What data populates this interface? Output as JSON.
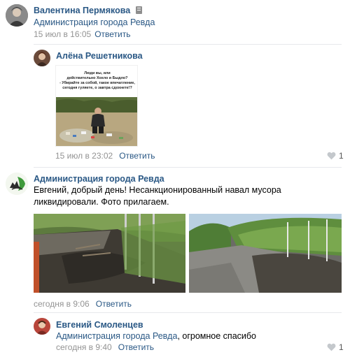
{
  "comments": [
    {
      "author": "Валентина Пермякова",
      "reply_to": "Администрация города Ревда",
      "time": "15 июл в 16:05",
      "reply_label": "Ответить"
    },
    {
      "author": "Алёна Решетникова",
      "image_caption": "Люди вы, или\nдействительно Хохло и Быдло?\n- Убирайте за собой, такое впечатление,\nсегодня гуляете, о завтра сдохнете!?",
      "time": "15 июл в 23:02",
      "reply_label": "Ответить",
      "likes": "1"
    },
    {
      "author": "Администрация города Ревда",
      "text_line1": "Евгений, добрый день! Несанкционированный навал мусора",
      "text_line2": "ликвидировали. Фото прилагаем.",
      "time": "сегодня в 9:06",
      "reply_label": "Ответить"
    },
    {
      "author": "Евгений Смоленцев",
      "reply_to": "Администрация города Ревда",
      "text_rest": ", огромное спасибо",
      "time": "сегодня в 9:40",
      "reply_label": "Ответить",
      "likes": "1"
    }
  ],
  "colors": {
    "link": "#2a5885",
    "meta": "#939393",
    "divider": "#e7e8ec"
  }
}
